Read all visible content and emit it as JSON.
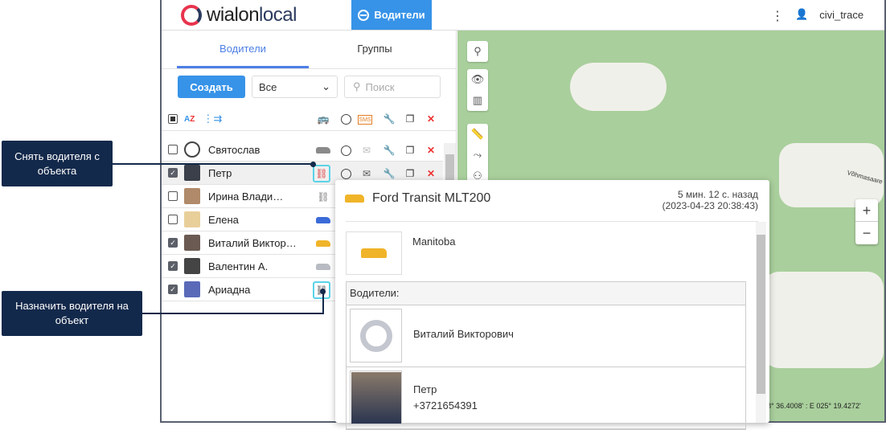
{
  "header": {
    "logo": "wialonlocal",
    "nav_button": "Водители",
    "user": "civi_trace"
  },
  "tabs": [
    {
      "label": "Водители",
      "active": true
    },
    {
      "label": "Группы",
      "active": false
    }
  ],
  "toolbar": {
    "create": "Создать",
    "filter": "Все",
    "search_placeholder": "Поиск"
  },
  "columns_icons": [
    "select-all",
    "sort-az",
    "group",
    "unit",
    "clock",
    "sms",
    "wrench",
    "copy",
    "delete"
  ],
  "drivers": [
    {
      "name": "Святослав",
      "checked": false,
      "car_color": "#8a8a8a"
    },
    {
      "name": "Петр",
      "checked": true,
      "car_color": "#e04040"
    },
    {
      "name": "Ирина Влади…",
      "checked": false,
      "car_color": ""
    },
    {
      "name": "Елена",
      "checked": false,
      "car_color": "#3a6bd8"
    },
    {
      "name": "Виталий Виктор…",
      "checked": true,
      "car_color": "#f0b429"
    },
    {
      "name": "Валентин А.",
      "checked": true,
      "car_color": "#b8bcc2"
    },
    {
      "name": "Ариадна",
      "checked": true,
      "car_color": ""
    }
  ],
  "callouts": {
    "unassign": "Снять водителя с объекта",
    "assign": "Назначить водителя на объект"
  },
  "popup": {
    "title": "Ford Transit MLT200",
    "time_ago": "5 мин. 12 с. назад",
    "time": "(2023-04-23 20:38:43)",
    "object": "Manitoba",
    "drivers_label": "Водители:",
    "drivers": [
      {
        "name": "Виталий Викторович"
      },
      {
        "name": "Петр",
        "phone": "+3721654391"
      }
    ]
  },
  "map": {
    "coords": "58° 36.4008' : E 025° 19.4272'",
    "zoom_in": "+",
    "zoom_out": "−",
    "road_label": "Võhmasaare"
  }
}
